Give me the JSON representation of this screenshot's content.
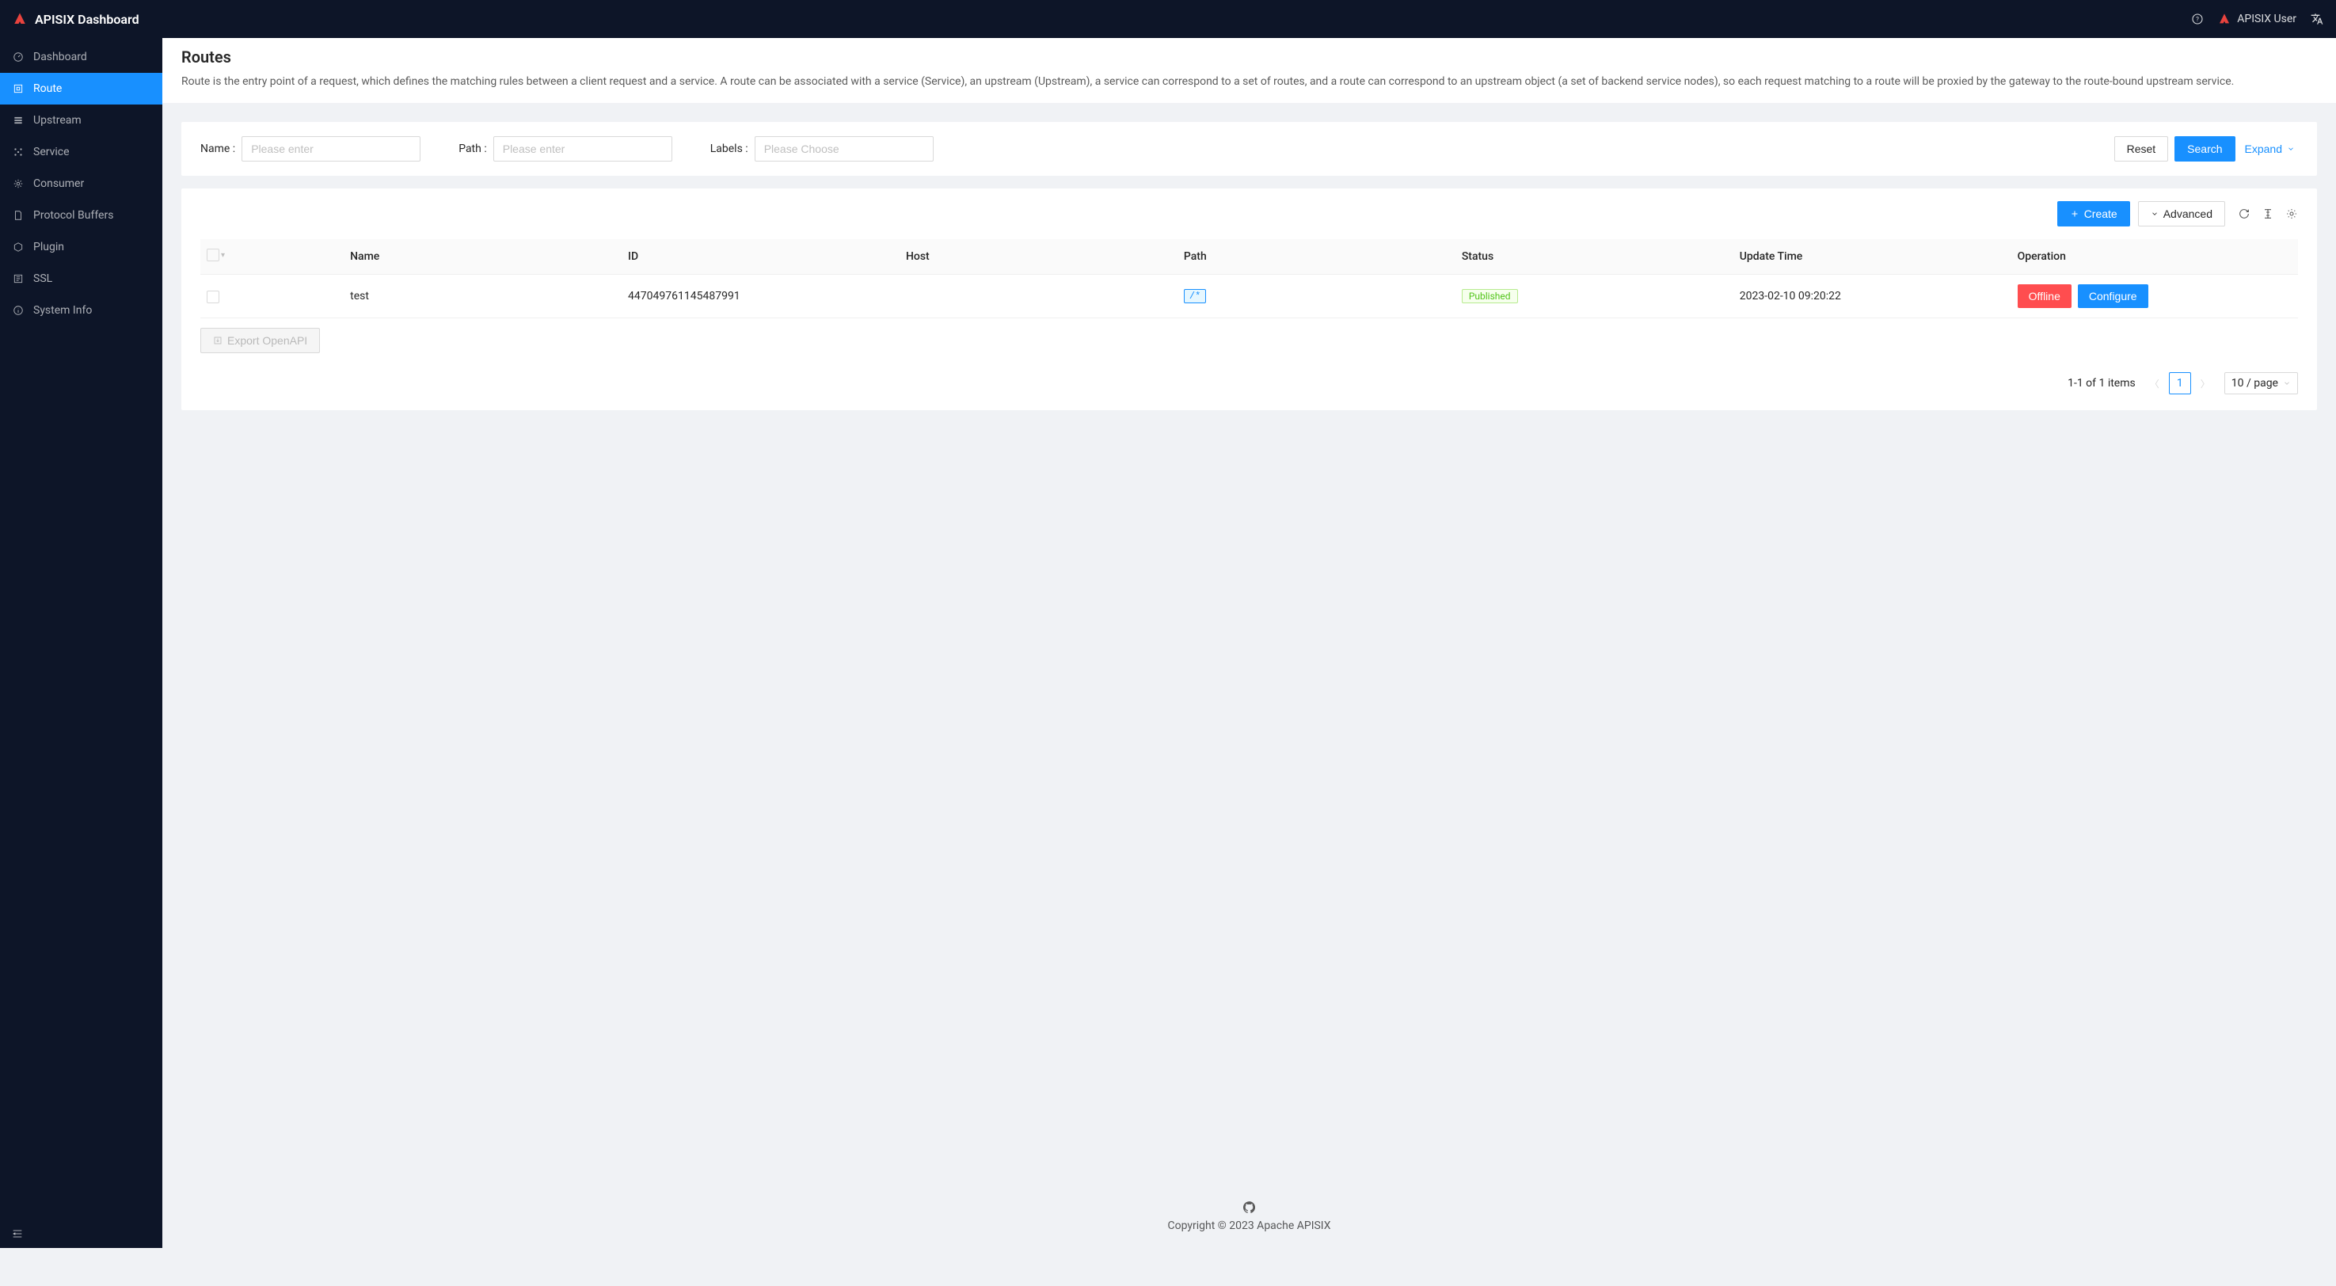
{
  "header": {
    "title": "APISIX Dashboard",
    "user_name": "APISIX User"
  },
  "sidebar": {
    "items": [
      {
        "label": "Dashboard",
        "active": false
      },
      {
        "label": "Route",
        "active": true
      },
      {
        "label": "Upstream",
        "active": false
      },
      {
        "label": "Service",
        "active": false
      },
      {
        "label": "Consumer",
        "active": false
      },
      {
        "label": "Protocol Buffers",
        "active": false
      },
      {
        "label": "Plugin",
        "active": false
      },
      {
        "label": "SSL",
        "active": false
      },
      {
        "label": "System Info",
        "active": false
      }
    ]
  },
  "page": {
    "title": "Routes",
    "description": "Route is the entry point of a request, which defines the matching rules between a client request and a service. A route can be associated with a service (Service), an upstream (Upstream), a service can correspond to a set of routes, and a route can correspond to an upstream object (a set of backend service nodes), so each request matching to a route will be proxied by the gateway to the route-bound upstream service."
  },
  "search": {
    "name_label": "Name",
    "name_placeholder": "Please enter",
    "path_label": "Path",
    "path_placeholder": "Please enter",
    "labels_label": "Labels",
    "labels_placeholder": "Please Choose",
    "reset": "Reset",
    "search": "Search",
    "expand": "Expand"
  },
  "toolbar": {
    "create": "Create",
    "advanced": "Advanced"
  },
  "table": {
    "columns": {
      "name": "Name",
      "id": "ID",
      "host": "Host",
      "path": "Path",
      "status": "Status",
      "update_time": "Update Time",
      "operation": "Operation"
    },
    "rows": [
      {
        "name": "test",
        "id": "447049761145487991",
        "host": "",
        "path": "/*",
        "status": "Published",
        "update_time": "2023-02-10 09:20:22"
      }
    ],
    "op": {
      "offline": "Offline",
      "configure": "Configure"
    },
    "export": "Export OpenAPI"
  },
  "pagination": {
    "summary": "1-1 of 1 items",
    "page": "1",
    "page_size": "10 / page"
  },
  "footer": {
    "copyright": "Copyright © 2023 Apache APISIX"
  }
}
